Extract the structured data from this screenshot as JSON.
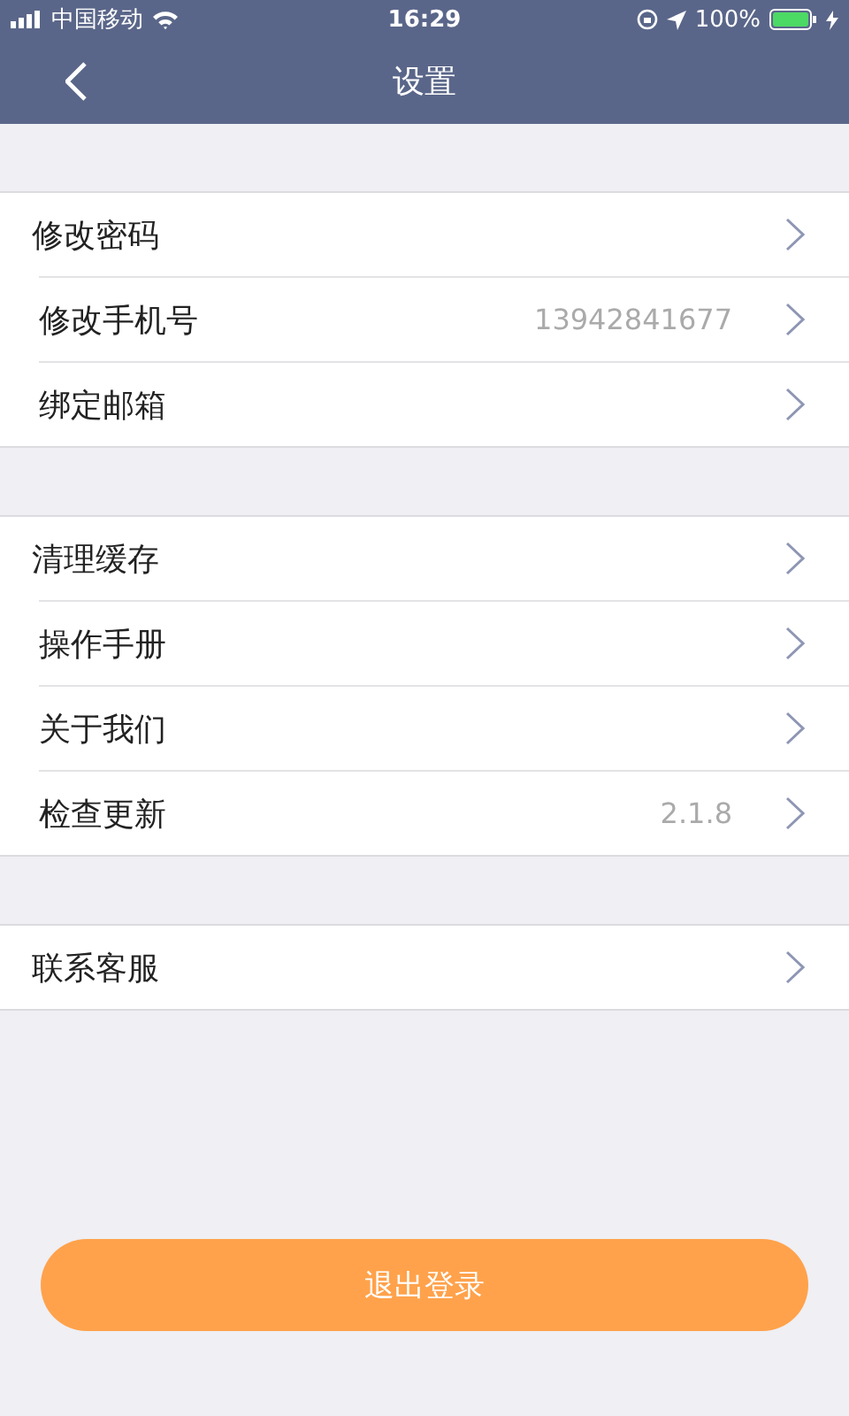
{
  "status_bar": {
    "carrier": "中国移动",
    "time": "16:29",
    "battery": "100%"
  },
  "nav": {
    "title": "设置"
  },
  "groups": [
    {
      "items": [
        {
          "label": "修改密码"
        },
        {
          "label": "修改手机号",
          "value": "13942841677"
        },
        {
          "label": "绑定邮箱"
        }
      ]
    },
    {
      "items": [
        {
          "label": "清理缓存"
        },
        {
          "label": "操作手册"
        },
        {
          "label": "关于我们"
        },
        {
          "label": "检查更新",
          "value": "2.1.8"
        }
      ]
    },
    {
      "items": [
        {
          "label": "联系客服"
        }
      ]
    }
  ],
  "logout_button": "退出登录"
}
